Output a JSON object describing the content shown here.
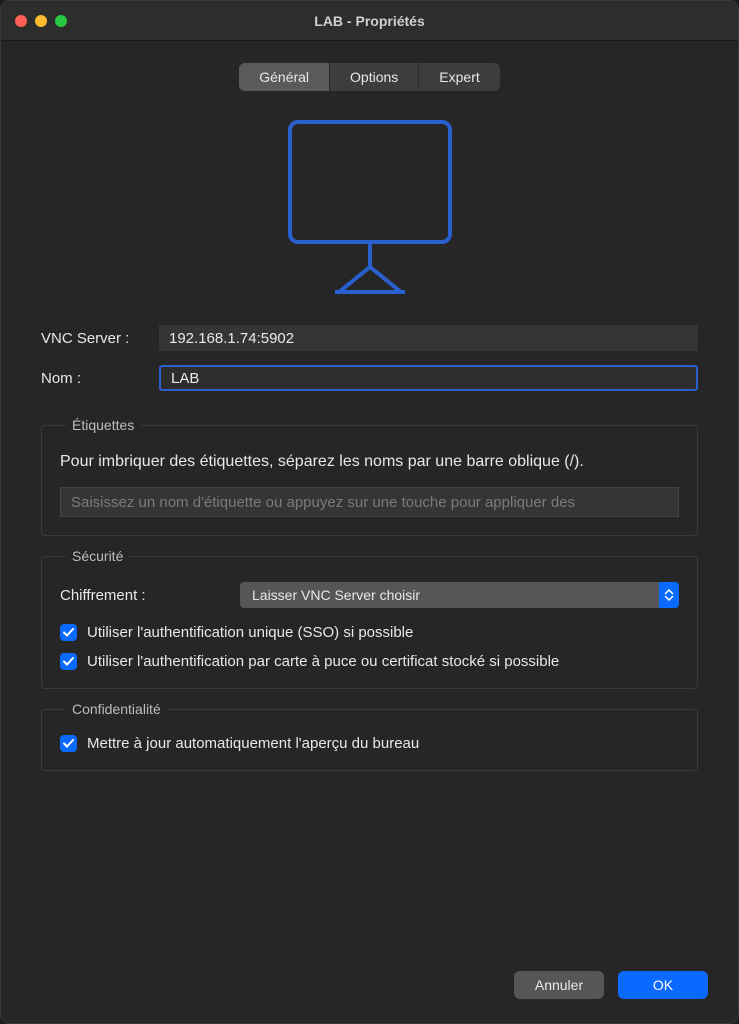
{
  "window": {
    "title": "LAB - Propriétés"
  },
  "tabs": {
    "general": "Général",
    "options": "Options",
    "expert": "Expert"
  },
  "form": {
    "vnc_server_label": "VNC Server :",
    "vnc_server_value": "192.168.1.74:5902",
    "name_label": "Nom :",
    "name_value": "LAB"
  },
  "labels_section": {
    "legend": "Étiquettes",
    "help": "Pour imbriquer des étiquettes, séparez les noms par une barre oblique (/).",
    "placeholder": "Saisissez un nom d'étiquette ou appuyez sur une touche pour appliquer des"
  },
  "security_section": {
    "legend": "Sécurité",
    "encryption_label": "Chiffrement :",
    "encryption_value": "Laisser VNC Server choisir",
    "sso_label": "Utiliser l'authentification unique (SSO) si possible",
    "smartcard_label": "Utiliser l'authentification par carte à puce ou certificat stocké si possible"
  },
  "privacy_section": {
    "legend": "Confidentialité",
    "preview_label": "Mettre à jour automatiquement l'aperçu du bureau"
  },
  "footer": {
    "cancel": "Annuler",
    "ok": "OK"
  },
  "colors": {
    "accent": "#0a69ff",
    "monitor_stroke": "#2a5fce"
  }
}
